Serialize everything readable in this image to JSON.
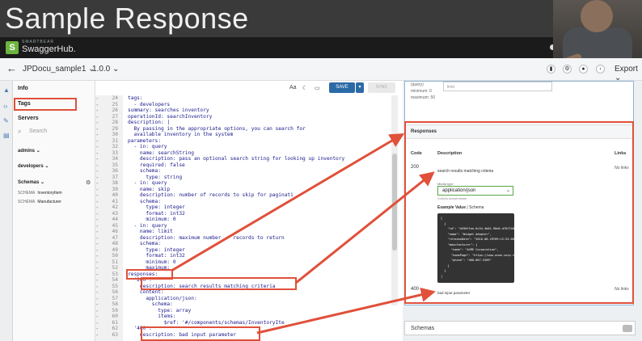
{
  "slide": {
    "title": "Sample Response"
  },
  "topbar": {
    "brand_small": "SMARTBEAR",
    "brand": "SwaggerHub."
  },
  "header": {
    "api_name": "JPDocu_sample1 ",
    "api_version": "1.0.0 ",
    "export_label": "Export "
  },
  "nav": {
    "items": [
      {
        "label": "Info"
      },
      {
        "label": "Tags"
      },
      {
        "label": "Servers"
      }
    ],
    "search_placeholder": "Search",
    "groups": [
      {
        "label": "admins "
      },
      {
        "label": "developers "
      }
    ],
    "schemas_label": "Schemas ",
    "schema_items": [
      {
        "tag": "SCHEMA",
        "name": "InventoryItem"
      },
      {
        "tag": "SCHEMA",
        "name": "Manufacturer"
      }
    ]
  },
  "toolbar": {
    "aa": "Aa",
    "save_label": "SAVE",
    "sync_label": "SYNC"
  },
  "editor": {
    "lines": [
      {
        "n": "24",
        "text": "tags:"
      },
      {
        "n": "25",
        "text": "  - developers"
      },
      {
        "n": "26",
        "text": "summary: searches inventory"
      },
      {
        "n": "27",
        "text": "operationId: searchInventory"
      },
      {
        "n": "28",
        "text": "description: |"
      },
      {
        "n": "29",
        "text": "  By passing in the appropriate options, you can search for"
      },
      {
        "n": "30",
        "text": "  available inventory in the system"
      },
      {
        "n": "31",
        "text": "parameters:"
      },
      {
        "n": "32",
        "text": "  - in: query"
      },
      {
        "n": "33",
        "text": "    name: searchString"
      },
      {
        "n": "34",
        "text": "    description: pass an optional search string for looking up inventory"
      },
      {
        "n": "35",
        "text": "    required: false"
      },
      {
        "n": "36",
        "text": "    schema:"
      },
      {
        "n": "37",
        "text": "      type: string"
      },
      {
        "n": "38",
        "text": "  - in: query"
      },
      {
        "n": "39",
        "text": "    name: skip"
      },
      {
        "n": "40",
        "text": "    description: number of records to skip for paginati"
      },
      {
        "n": "41",
        "text": "    schema:"
      },
      {
        "n": "42",
        "text": "      type: integer"
      },
      {
        "n": "43",
        "text": "      format: int32"
      },
      {
        "n": "44",
        "text": "      minimum: 0"
      },
      {
        "n": "45",
        "text": "  - in: query"
      },
      {
        "n": "46",
        "text": "    name: limit"
      },
      {
        "n": "47",
        "text": "    description: maximum number    records to return"
      },
      {
        "n": "48",
        "text": "    schema:"
      },
      {
        "n": "49",
        "text": "      type: integer"
      },
      {
        "n": "50",
        "text": "      format: int32"
      },
      {
        "n": "51",
        "text": "      minimum: 0"
      },
      {
        "n": "52",
        "text": "      maximum:"
      },
      {
        "n": "53",
        "text": "responses:"
      },
      {
        "n": "54",
        "text": "  '200':"
      },
      {
        "n": "55",
        "text": "    description: search results matching criteria"
      },
      {
        "n": "56",
        "text": "    content:"
      },
      {
        "n": "57",
        "text": "      application/json:"
      },
      {
        "n": "58",
        "text": "        schema:"
      },
      {
        "n": "59",
        "text": "          type: array"
      },
      {
        "n": "60",
        "text": "          items:"
      },
      {
        "n": "61",
        "text": "            $ref: '#/components/schemas/InventoryIte"
      },
      {
        "n": "62",
        "text": "  '400':"
      },
      {
        "n": "63",
        "text": "    description: bad input parameter"
      }
    ]
  },
  "docs": {
    "param_in": "(query)",
    "param_min": "minimum: 0",
    "param_max": "maximum: 50",
    "limit_placeholder": "limit",
    "responses_title": "Responses",
    "col_code": "Code",
    "col_description": "Description",
    "col_links": "Links",
    "r200_code": "200",
    "r200_desc": "search results matching criteria",
    "no_links": "No links",
    "media_type_label": "Media type",
    "media_type_value": "application/json",
    "controls_note": "Controls Accept header.",
    "example_tab": "Example Value",
    "schema_tab": "Schema",
    "example_lines": [
      "[",
      "  {",
      "    \"id\": \"d290f1ee-6c54-4b01-90e6-d701748f0851\",",
      "    \"name\": \"Widget Adapter\",",
      "    \"releaseDate\": \"2016-08-29T09:12:33.001Z\",",
      "    \"manufacturer\": {",
      "      \"name\": \"ACME Corporation\",",
      "      \"homePage\": \"https://www.acme-corp.com\",",
      "      \"phone\": \"408-867-5309\"",
      "    }",
      "  }",
      "]"
    ],
    "r400_code": "400",
    "r400_desc": "bad input parameter",
    "schemas_label": "Schemas"
  },
  "colors": {
    "accent": "#2b6aa6",
    "highlight": "#e0503a",
    "brand": "#6cb43f"
  }
}
